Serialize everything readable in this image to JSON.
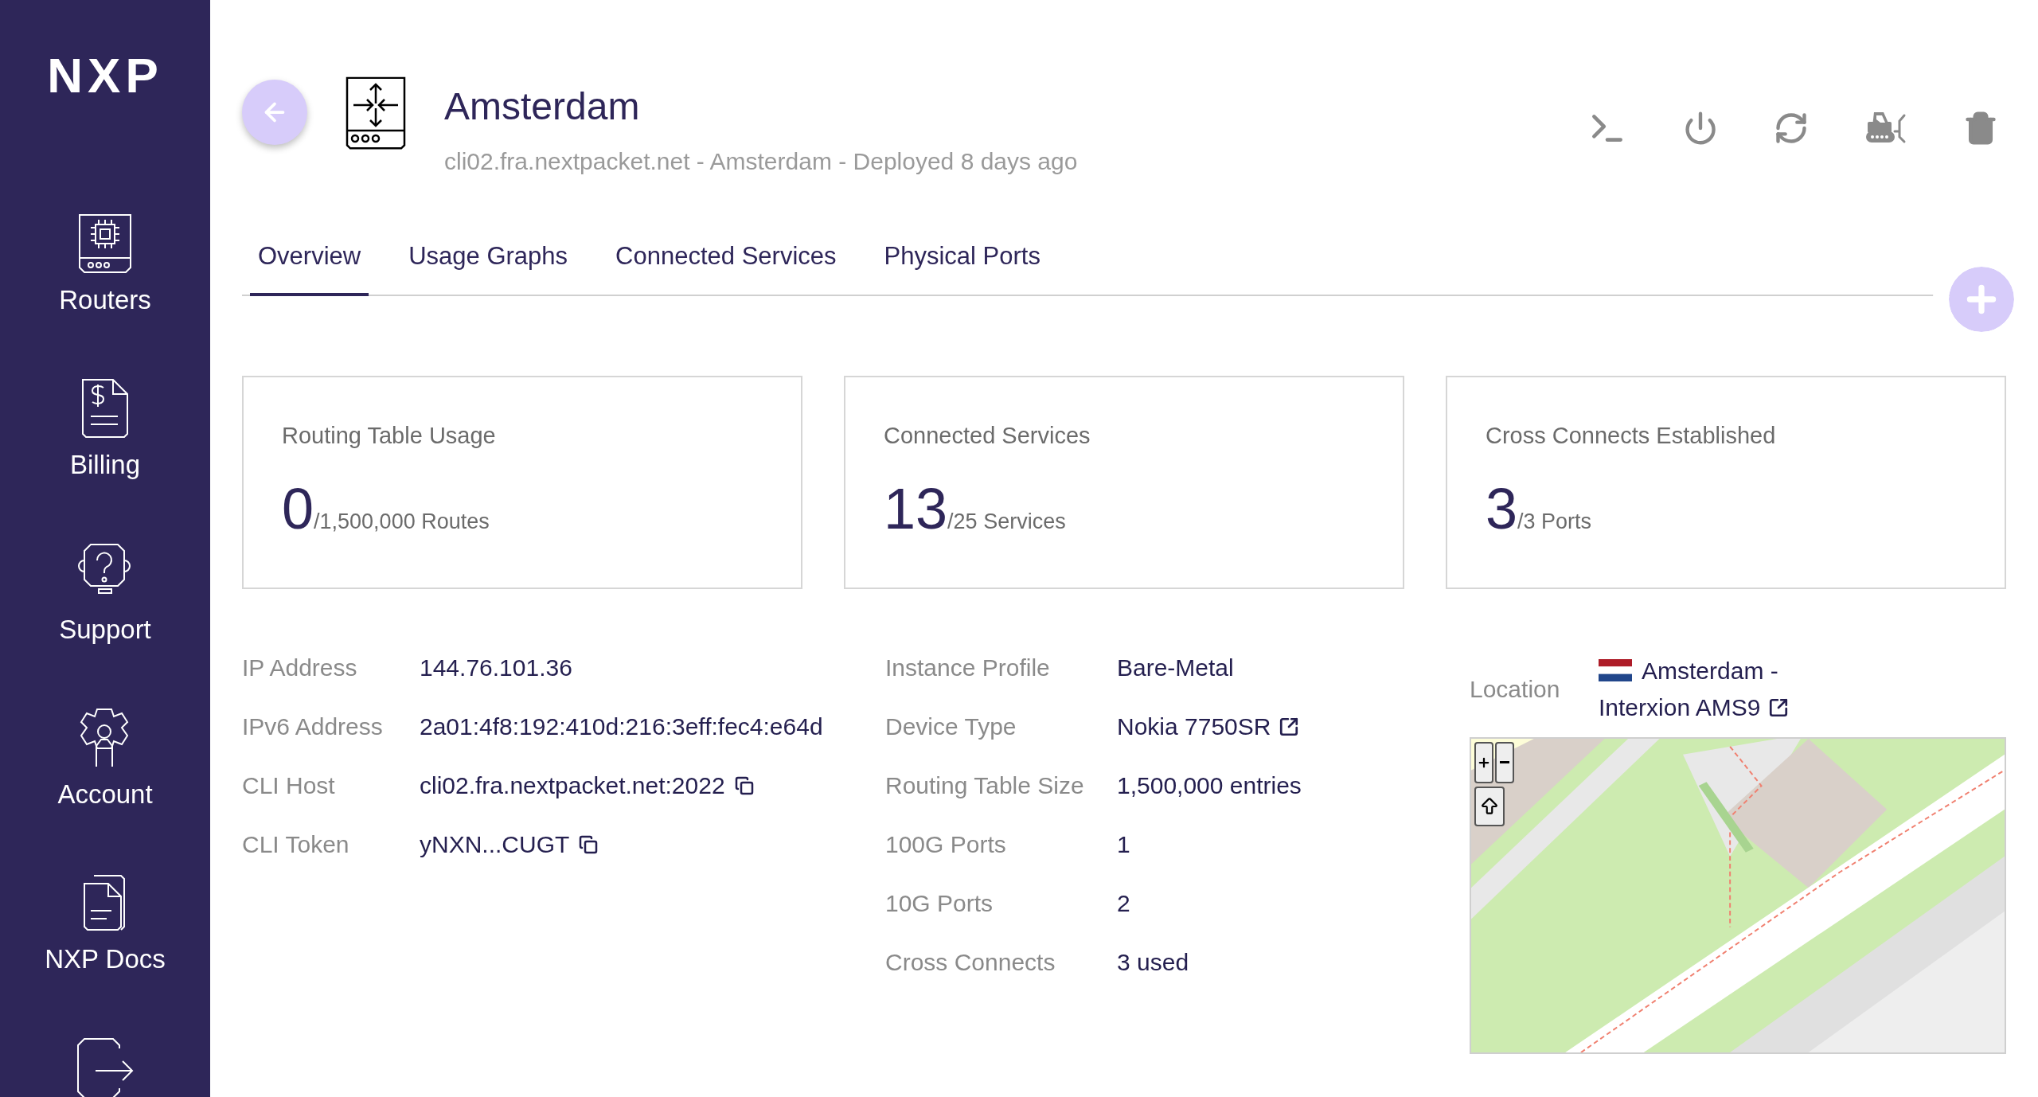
{
  "sidebar": {
    "logo": "NXP",
    "items": [
      {
        "label": "Routers"
      },
      {
        "label": "Billing"
      },
      {
        "label": "Support"
      },
      {
        "label": "Account"
      },
      {
        "label": "NXP Docs"
      }
    ]
  },
  "header": {
    "title": "Amsterdam",
    "subtitle": "cli02.fra.nextpacket.net - Amsterdam - Deployed 8 days ago"
  },
  "tabs": [
    {
      "label": "Overview",
      "selected": true
    },
    {
      "label": "Usage Graphs",
      "selected": false
    },
    {
      "label": "Connected Services",
      "selected": false
    },
    {
      "label": "Physical Ports",
      "selected": false
    }
  ],
  "cards": [
    {
      "title": "Routing Table Usage",
      "value": "0",
      "total": "/1,500,000 Routes"
    },
    {
      "title": "Connected Services",
      "value": "13",
      "total": "/25 Services"
    },
    {
      "title": "Cross Connects Established",
      "value": "3",
      "total": "/3 Ports"
    }
  ],
  "details": [
    [
      {
        "label": "IP Address",
        "value": "144.76.101.36",
        "kind": "plain"
      },
      {
        "label": "IPv6 Address",
        "value": "2a01:4f8:192:410d:216:3eff:fec4:e64d",
        "kind": "plain"
      },
      {
        "label": "CLI Host",
        "value": "cli02.fra.nextpacket.net:2022",
        "kind": "copy"
      },
      {
        "label": "CLI Token",
        "value": "yNXN...CUGT",
        "kind": "copy"
      }
    ],
    [
      {
        "label": "Instance Profile",
        "value": "Bare-Metal",
        "kind": "plain"
      },
      {
        "label": "Device Type",
        "value": "Nokia 7750SR",
        "kind": "link"
      },
      {
        "label": "Routing Table Size",
        "value": "1,500,000 entries",
        "kind": "plain"
      },
      {
        "label": "100G Ports",
        "value": "1",
        "kind": "plain"
      },
      {
        "label": "10G Ports",
        "value": "2",
        "kind": "plain"
      },
      {
        "label": "Cross Connects",
        "value": "3 used",
        "kind": "plain"
      }
    ]
  ],
  "location": {
    "label": "Location",
    "name": "Amsterdam - Interxion AMS9"
  }
}
